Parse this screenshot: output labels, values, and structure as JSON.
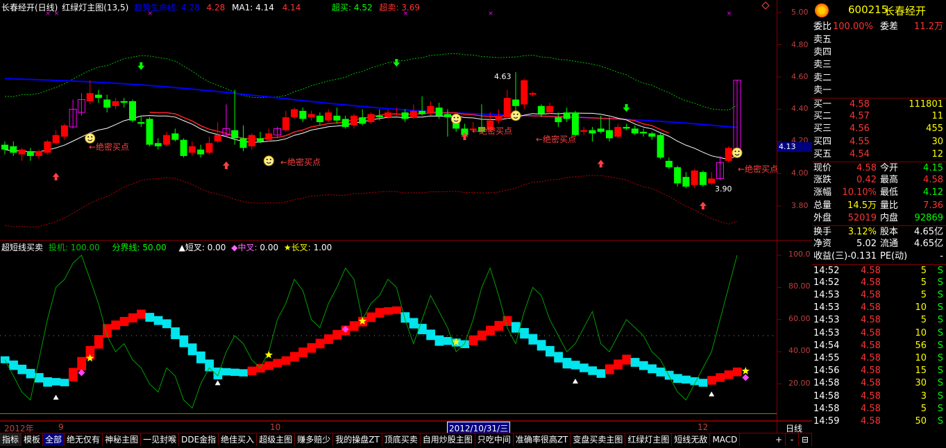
{
  "header": {
    "stock_title": "长春经开(日线)",
    "indicator_name": "红绿灯主图(13,5)",
    "trend_label": "趋势生命线:",
    "trend_value": "4.28",
    "trend_value2": "4.28",
    "ma1_label": "MA1:",
    "ma1_value": "4.14",
    "ma1_value2": "4.14",
    "overbought_label": "超买:",
    "overbought_value": "4.52",
    "oversold_label": "超卖:",
    "oversold_value": "3.69"
  },
  "price_axis": [
    "5.00",
    "4.80",
    "4.60",
    "4.40",
    "4.20",
    "4.00",
    "3.80"
  ],
  "current_price_tag": "4.13",
  "price_annotations": {
    "high_label": "4.63",
    "low_label": "3.90",
    "buy_point": "←绝密买点"
  },
  "sub_header": {
    "name": "超短线买卖",
    "tj_label": "投机:",
    "tj_value": "100.00",
    "fj_label": "分界线:",
    "fj_value": "50.00",
    "short_label": "▲短叉:",
    "short_value": "0.00",
    "mid_label": "◆中叉:",
    "mid_value": "0.00",
    "long_label": "★长叉:",
    "long_value": "1.00"
  },
  "sub_axis": [
    "100.0",
    "80.00",
    "60.00",
    "40.00",
    "20.00"
  ],
  "date_axis": {
    "year": "2012年",
    "m9": "9",
    "m10": "10",
    "cursor_date": "2012/10/31/三",
    "m12": "12",
    "period": "日线"
  },
  "bottom_tabs": [
    "指标",
    "模板",
    "全部",
    "绝无仅有",
    "神秘主图",
    "一见封喉",
    "DDE金指",
    "绝佳买入",
    "超级主图",
    "赚多赔少",
    "我的操盘ZT",
    "顶底买卖",
    "自用炒股主图",
    "只吃中间",
    "准确率很高ZT",
    "变盘买卖主图",
    "红绿灯主图",
    "短线无敌",
    "MACD"
  ],
  "bottom_controls": [
    "+",
    "-",
    "⊟"
  ],
  "quote": {
    "code": "600215",
    "name": "长春经开",
    "wb_label": "委比",
    "wb_value": "100.00%",
    "wc_label": "委差",
    "wc_value": "11.2万",
    "asks": [
      {
        "label": "卖五"
      },
      {
        "label": "卖四"
      },
      {
        "label": "卖三"
      },
      {
        "label": "卖二"
      },
      {
        "label": "卖一"
      }
    ],
    "bids": [
      {
        "label": "买一",
        "price": "4.58",
        "vol": "111801"
      },
      {
        "label": "买二",
        "price": "4.57",
        "vol": "11"
      },
      {
        "label": "买三",
        "price": "4.56",
        "vol": "455"
      },
      {
        "label": "买四",
        "price": "4.55",
        "vol": "30"
      },
      {
        "label": "买五",
        "price": "4.54",
        "vol": "12"
      }
    ],
    "stats": [
      {
        "l1": "现价",
        "v1": "4.58",
        "l2": "今开",
        "v2": "4.15"
      },
      {
        "l1": "涨跌",
        "v1": "0.42",
        "l2": "最高",
        "v2": "4.58"
      },
      {
        "l1": "涨幅",
        "v1": "10.10%",
        "l2": "最低",
        "v2": "4.12"
      },
      {
        "l1": "总量",
        "v1": "14.5万",
        "l2": "量比",
        "v2": "7.36"
      },
      {
        "l1": "外盘",
        "v1": "52019",
        "l2": "内盘",
        "v2": "92869"
      }
    ],
    "stats2": [
      {
        "l1": "换手",
        "v1": "3.12%",
        "l2": "股本",
        "v2": "4.65亿"
      },
      {
        "l1": "净资",
        "v1": "5.02",
        "l2": "流通",
        "v2": "4.65亿"
      },
      {
        "l1": "收益(三)",
        "v1": "-0.131",
        "l2": "PE(动)",
        "v2": "-"
      }
    ],
    "ticks": [
      {
        "t": "14:52",
        "p": "4.58",
        "v": "5",
        "s": "S"
      },
      {
        "t": "14:52",
        "p": "4.58",
        "v": "5",
        "s": "S"
      },
      {
        "t": "14:53",
        "p": "4.58",
        "v": "5",
        "s": "S"
      },
      {
        "t": "14:53",
        "p": "4.58",
        "v": "10",
        "s": "S"
      },
      {
        "t": "14:53",
        "p": "4.58",
        "v": "5",
        "s": "S"
      },
      {
        "t": "14:53",
        "p": "4.58",
        "v": "10",
        "s": "S"
      },
      {
        "t": "14:54",
        "p": "4.58",
        "v": "56",
        "s": "S"
      },
      {
        "t": "14:55",
        "p": "4.58",
        "v": "10",
        "s": "S"
      },
      {
        "t": "14:56",
        "p": "4.58",
        "v": "15",
        "s": "S"
      },
      {
        "t": "14:58",
        "p": "4.58",
        "v": "30",
        "s": "S"
      },
      {
        "t": "14:58",
        "p": "4.58",
        "v": "3",
        "s": "S"
      },
      {
        "t": "14:58",
        "p": "4.58",
        "v": "5",
        "s": "S"
      },
      {
        "t": "14:59",
        "p": "4.58",
        "v": "50",
        "s": "S"
      }
    ]
  },
  "colors": {
    "up": "#ff0000",
    "down": "#00ff00",
    "bull_box": "#ff00ff",
    "trend": "#0000ff",
    "ma": "#ffffff",
    "cyan": "#00e5ee",
    "axis_red": "#7f0000"
  },
  "chart_data": {
    "type": "candlestick",
    "price_ylim": [
      3.7,
      5.05
    ],
    "candles": [
      [
        4.18,
        4.15,
        4.2,
        4.12
      ],
      [
        4.17,
        4.13,
        4.2,
        4.11
      ],
      [
        4.12,
        4.15,
        4.16,
        4.08
      ],
      [
        4.14,
        4.11,
        4.16,
        4.08
      ],
      [
        4.11,
        4.14,
        4.15,
        4.09
      ],
      [
        4.13,
        4.2,
        4.21,
        4.12
      ],
      [
        4.19,
        4.24,
        4.27,
        4.18
      ],
      [
        4.23,
        4.3,
        4.31,
        4.21
      ],
      [
        4.29,
        4.4,
        4.46,
        4.28
      ],
      [
        4.38,
        4.46,
        4.5,
        4.36
      ],
      [
        4.45,
        4.5,
        4.58,
        4.43
      ],
      [
        4.49,
        4.47,
        4.52,
        4.44
      ],
      [
        4.46,
        4.41,
        4.49,
        4.38
      ],
      [
        4.42,
        4.45,
        4.47,
        4.4
      ],
      [
        4.45,
        4.44,
        4.47,
        4.41
      ],
      [
        4.45,
        4.33,
        4.46,
        4.32
      ],
      [
        4.32,
        4.31,
        4.36,
        4.29
      ],
      [
        4.34,
        4.18,
        4.35,
        4.17
      ],
      [
        4.19,
        4.17,
        4.22,
        4.15
      ],
      [
        4.18,
        4.24,
        4.26,
        4.17
      ],
      [
        4.25,
        4.21,
        4.28,
        4.2
      ],
      [
        4.21,
        4.11,
        4.22,
        4.1
      ],
      [
        4.13,
        4.17,
        4.2,
        4.11
      ],
      [
        4.15,
        4.12,
        4.18,
        4.1
      ],
      [
        4.13,
        4.19,
        4.23,
        4.12
      ],
      [
        4.2,
        4.24,
        4.32,
        4.19
      ],
      [
        4.24,
        4.28,
        4.43,
        4.23
      ],
      [
        4.27,
        4.22,
        4.52,
        4.18
      ],
      [
        4.22,
        4.16,
        4.3,
        4.14
      ],
      [
        4.17,
        4.24,
        4.25,
        4.15
      ],
      [
        4.22,
        4.2,
        4.26,
        4.19
      ],
      [
        4.21,
        4.25,
        4.28,
        4.2
      ],
      [
        4.24,
        4.28,
        4.29,
        4.22
      ],
      [
        4.27,
        4.35,
        4.39,
        4.26
      ],
      [
        4.35,
        4.4,
        4.41,
        4.34
      ],
      [
        4.39,
        4.34,
        4.41,
        4.32
      ],
      [
        4.35,
        4.37,
        4.39,
        4.33
      ],
      [
        4.36,
        4.32,
        4.38,
        4.3
      ],
      [
        4.33,
        4.38,
        4.4,
        4.32
      ],
      [
        4.36,
        4.33,
        4.41,
        4.31
      ],
      [
        4.34,
        4.29,
        4.36,
        4.28
      ],
      [
        4.3,
        4.36,
        4.37,
        4.28
      ],
      [
        4.35,
        4.31,
        4.4,
        4.3
      ],
      [
        4.32,
        4.37,
        4.38,
        4.31
      ],
      [
        4.36,
        4.35,
        4.4,
        4.33
      ],
      [
        4.35,
        4.38,
        4.4,
        4.34
      ],
      [
        4.37,
        4.37,
        4.41,
        4.36
      ],
      [
        4.38,
        4.34,
        4.4,
        4.32
      ],
      [
        4.35,
        4.39,
        4.43,
        4.34
      ],
      [
        4.39,
        4.37,
        4.48,
        4.36
      ],
      [
        4.38,
        4.42,
        4.45,
        4.36
      ],
      [
        4.41,
        4.36,
        4.44,
        4.34
      ],
      [
        4.37,
        4.35,
        4.4,
        4.23
      ],
      [
        4.34,
        4.28,
        4.36,
        4.26
      ],
      [
        4.28,
        4.24,
        4.31,
        4.23
      ],
      [
        4.27,
        4.28,
        4.32,
        4.26
      ],
      [
        4.29,
        4.26,
        4.43,
        4.25
      ],
      [
        4.27,
        4.33,
        4.38,
        4.26
      ],
      [
        4.33,
        4.36,
        4.4,
        4.31
      ],
      [
        4.35,
        4.47,
        4.52,
        4.34
      ],
      [
        4.46,
        4.42,
        4.63,
        4.38
      ],
      [
        4.43,
        4.58,
        4.59,
        4.4
      ],
      [
        4.49,
        4.5,
        4.51,
        4.48
      ],
      [
        4.42,
        4.37,
        4.43,
        4.35
      ],
      [
        4.38,
        4.42,
        4.44,
        4.37
      ],
      [
        4.35,
        4.32,
        4.38,
        4.29
      ],
      [
        4.38,
        4.34,
        4.41,
        4.32
      ],
      [
        4.38,
        4.24,
        4.39,
        4.23
      ],
      [
        4.26,
        4.27,
        4.29,
        4.24
      ],
      [
        4.27,
        4.25,
        4.29,
        4.2
      ],
      [
        4.28,
        4.26,
        4.36,
        4.25
      ],
      [
        4.27,
        4.22,
        4.35,
        4.2
      ],
      [
        4.23,
        4.29,
        4.31,
        4.22
      ],
      [
        4.29,
        4.28,
        4.31,
        4.27
      ],
      [
        4.28,
        4.25,
        4.3,
        4.24
      ],
      [
        4.26,
        4.25,
        4.28,
        4.23
      ],
      [
        4.25,
        4.23,
        4.26,
        4.21
      ],
      [
        4.24,
        4.1,
        4.25,
        4.09
      ],
      [
        4.08,
        4.04,
        4.1,
        4.03
      ],
      [
        4.04,
        3.94,
        4.05,
        3.92
      ],
      [
        3.98,
        3.92,
        4.01,
        3.91
      ],
      [
        3.93,
        4.02,
        4.03,
        3.91
      ],
      [
        4.01,
        3.93,
        4.02,
        3.92
      ],
      [
        3.94,
        3.97,
        4.01,
        3.93
      ],
      [
        3.97,
        4.07,
        4.11,
        3.96
      ],
      [
        4.08,
        4.16,
        4.17,
        4.07
      ],
      [
        4.15,
        4.58,
        4.58,
        4.12
      ]
    ]
  }
}
